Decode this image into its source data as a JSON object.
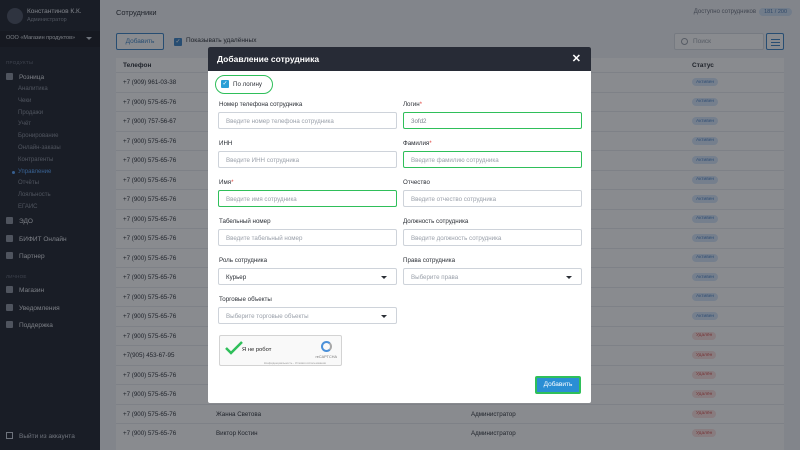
{
  "sidebar": {
    "user_name": "Константинов К.К.",
    "user_role": "Администратор",
    "org": "ООО «Магазин продуктов»",
    "section_products": "ПРОДУКТЫ",
    "retail": "Розница",
    "retail_items": [
      "Аналитика",
      "Чеки",
      "Продажи",
      "Учёт",
      "Бронирование",
      "Онлайн-заказы",
      "Контрагенты",
      "Управление",
      "Отчёты",
      "Лояльность",
      "ЕГАИС"
    ],
    "edo": "ЭДО",
    "bifit": "БИФИТ Онлайн",
    "partner": "Партнер",
    "section_personal": "ЛИЧНОЕ",
    "shop": "Магазин",
    "notifications": "Уведомления",
    "support": "Поддержка",
    "logout": "Выйти из аккаунта"
  },
  "topbar": {
    "title": "Сотрудники",
    "available_label": "Доступно сотрудников",
    "available_count": "181 / 200"
  },
  "toolbar": {
    "add_button": "Добавить",
    "show_deleted": "Показывать удалённых",
    "search_placeholder": "Поиск"
  },
  "table": {
    "col_phone": "Телефон",
    "col_status": "Статус",
    "rows": [
      {
        "phone": "+7 (909) 961-03-38",
        "name": "",
        "role": "",
        "status": "Активен",
        "kind": "ok"
      },
      {
        "phone": "+7 (900) 575-65-76",
        "name": "",
        "role": "",
        "status": "Активен",
        "kind": "ok"
      },
      {
        "phone": "+7 (900) 757-56-67",
        "name": "",
        "role": "",
        "status": "Активен",
        "kind": "ok"
      },
      {
        "phone": "+7 (900) 575-65-76",
        "name": "",
        "role": "",
        "status": "Активен",
        "kind": "ok"
      },
      {
        "phone": "+7 (900) 575-65-76",
        "name": "",
        "role": "",
        "status": "Активен",
        "kind": "ok"
      },
      {
        "phone": "+7 (900) 575-65-76",
        "name": "",
        "role": "",
        "status": "Активен",
        "kind": "ok"
      },
      {
        "phone": "+7 (900) 575-65-76",
        "name": "",
        "role": "",
        "status": "Активен",
        "kind": "ok"
      },
      {
        "phone": "+7 (900) 575-65-76",
        "name": "",
        "role": "",
        "status": "Активен",
        "kind": "ok"
      },
      {
        "phone": "+7 (900) 575-65-76",
        "name": "",
        "role": "",
        "status": "Активен",
        "kind": "ok"
      },
      {
        "phone": "+7 (900) 575-65-76",
        "name": "",
        "role": "",
        "status": "Активен",
        "kind": "ok"
      },
      {
        "phone": "+7 (900) 575-65-76",
        "name": "",
        "role": "",
        "status": "Активен",
        "kind": "ok"
      },
      {
        "phone": "+7 (900) 575-65-76",
        "name": "",
        "role": "",
        "status": "Активен",
        "kind": "ok"
      },
      {
        "phone": "+7 (900) 575-65-76",
        "name": "",
        "role": "",
        "status": "Активен",
        "kind": "ok"
      },
      {
        "phone": "+7 (900) 575-65-76",
        "name": "",
        "role": "",
        "status": "Удалён",
        "kind": "del"
      },
      {
        "phone": "+7(905) 453-67-95",
        "name": "",
        "role": "",
        "status": "Удалён",
        "kind": "del"
      },
      {
        "phone": "+7 (900) 575-65-76",
        "name": "",
        "role": "",
        "status": "Удалён",
        "kind": "del"
      },
      {
        "phone": "+7 (900) 575-65-76",
        "name": "",
        "role": "",
        "status": "Удалён",
        "kind": "del"
      },
      {
        "phone": "+7 (900) 575-65-76",
        "name": "Жанна Светова",
        "role": "Администратор",
        "status": "Удалён",
        "kind": "del"
      },
      {
        "phone": "+7 (900) 575-65-76",
        "name": "Виктор Костин",
        "role": "Администратор",
        "status": "Удалён",
        "kind": "del"
      }
    ]
  },
  "modal": {
    "title": "Добавление сотрудника",
    "by_login": "По логину",
    "phone_label": "Номер телефона сотрудника",
    "phone_placeholder": "Введите номер телефона сотрудника",
    "login_label": "Логин",
    "login_value": "3ofd2",
    "inn_label": "ИНН",
    "inn_placeholder": "Введите ИНН сотрудника",
    "surname_label": "Фамилия",
    "surname_placeholder": "Введите фамилию сотрудника",
    "name_label": "Имя",
    "name_placeholder": "Введите имя сотрудника",
    "patronymic_label": "Отчество",
    "patronymic_placeholder": "Введите отчество сотрудника",
    "tab_label": "Табельный номер",
    "tab_placeholder": "Введите табельный номер",
    "position_label": "Должность сотрудника",
    "position_placeholder": "Введите должность сотрудника",
    "role_label": "Роль сотрудника",
    "role_value": "Курьер",
    "rights_label": "Права сотрудника",
    "rights_placeholder": "Выберите права",
    "objects_label": "Торговые объекты",
    "objects_placeholder": "Выберите торговые объекты",
    "captcha_text": "Я не робот",
    "captcha_brand": "reCAPTCHA",
    "captcha_privacy": "Конфиденциальность - Условия использования",
    "submit": "Добавить",
    "required_mark": "*"
  },
  "colors": {
    "accent": "#2a8ed4",
    "highlight": "#2fbf5a",
    "sidebar_bg": "#1f232d",
    "modal_header": "#272b36"
  }
}
